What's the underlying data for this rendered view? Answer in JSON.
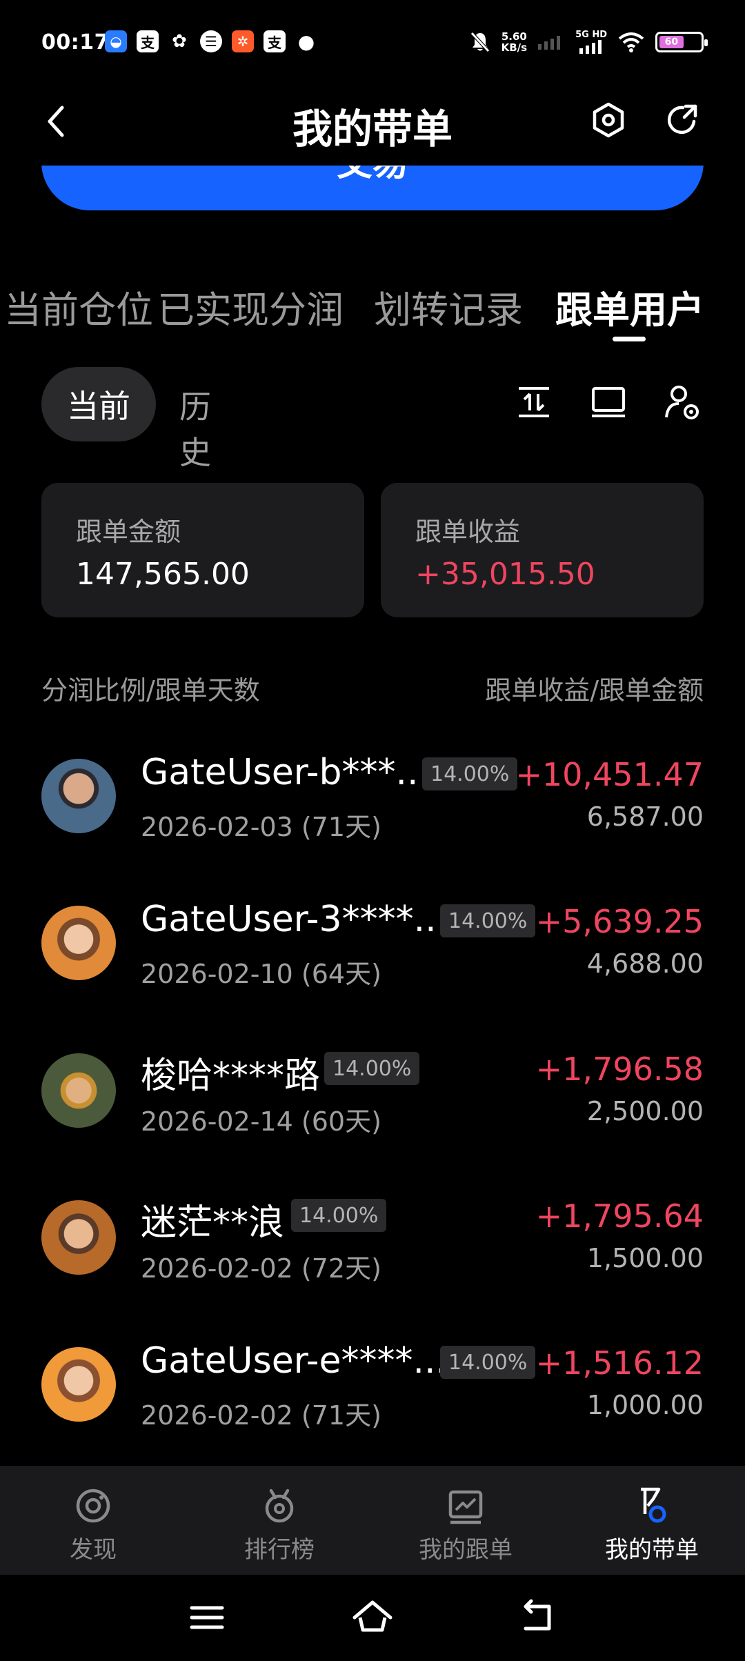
{
  "status_bar": {
    "time": "00:17",
    "net_speed_value": "5.60",
    "net_speed_unit": "KB/s",
    "signal_label_top": "5G HD",
    "battery_level": "60",
    "app_icons": [
      "baidu-icon",
      "alipay-icon",
      "wechat-icon",
      "app-icon",
      "taobao-icon",
      "alipay-icon",
      "message-icon"
    ]
  },
  "header": {
    "title": "我的带单"
  },
  "trade_button": {
    "label": "交易"
  },
  "tabs": [
    {
      "label": "当前仓位",
      "active": false
    },
    {
      "label": "已实现分润",
      "active": false
    },
    {
      "label": "划转记录",
      "active": false
    },
    {
      "label": "跟单用户",
      "active": true
    }
  ],
  "segment": {
    "current": "当前",
    "history": "历史"
  },
  "summary": {
    "amount_label": "跟单金额",
    "amount_value": "147,565.00",
    "profit_label": "跟单收益",
    "profit_value": "+35,015.50"
  },
  "list_header": {
    "left": "分润比例/跟单天数",
    "right": "跟单收益/跟单金额"
  },
  "followers": [
    {
      "name": "GateUser-b***...",
      "share": "14.00%",
      "date": "2026-02-03 (71天)",
      "profit": "+10,451.47",
      "amount": "6,587.00"
    },
    {
      "name": "GateUser-3****...",
      "share": "14.00%",
      "date": "2026-02-10 (64天)",
      "profit": "+5,639.25",
      "amount": "4,688.00"
    },
    {
      "name": "梭哈****路",
      "share": "14.00%",
      "date": "2026-02-14 (60天)",
      "profit": "+1,796.58",
      "amount": "2,500.00"
    },
    {
      "name": "迷茫**浪",
      "share": "14.00%",
      "date": "2026-02-02 (72天)",
      "profit": "+1,795.64",
      "amount": "1,500.00"
    },
    {
      "name": "GateUser-e****...",
      "share": "14.00%",
      "date": "2026-02-02 (71天)",
      "profit": "+1,516.12",
      "amount": "1,000.00"
    }
  ],
  "bottom_nav": [
    {
      "label": "发现",
      "icon": "discover-icon",
      "active": false
    },
    {
      "label": "排行榜",
      "icon": "medal-icon",
      "active": false
    },
    {
      "label": "我的跟单",
      "icon": "chart-icon",
      "active": false
    },
    {
      "label": "我的带单",
      "icon": "flag-icon",
      "active": true
    }
  ],
  "colors": {
    "accent_blue": "#1763ff",
    "profit_red": "#f0455f",
    "card_bg": "#1c1c1f"
  }
}
